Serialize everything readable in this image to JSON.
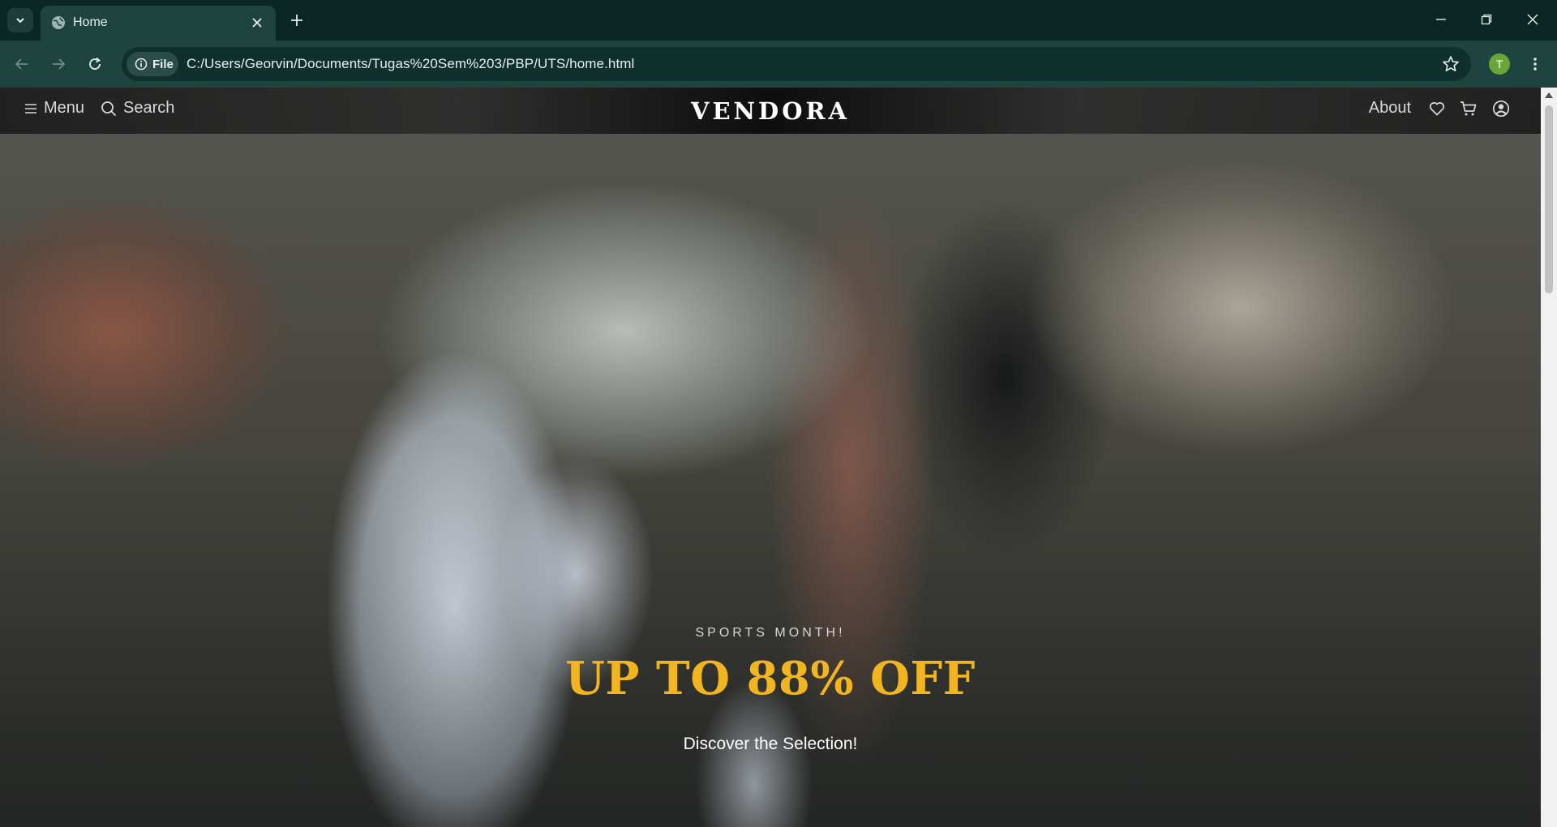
{
  "browser": {
    "tab_title": "Home",
    "address_chip": "File",
    "url": "C:/Users/Georvin/Documents/Tugas%20Sem%203/PBP/UTS/home.html",
    "profile_initial": "T",
    "profile_color": "#6aa53a"
  },
  "site": {
    "nav": {
      "menu_label": "Menu",
      "search_label": "Search",
      "brand": "VENDORA",
      "about_label": "About"
    },
    "hero": {
      "kicker": "SPORTS MONTH!",
      "headline": "UP TO 88% OFF",
      "cta": "Discover the Selection!",
      "accent_color": "#f2b41f"
    }
  },
  "icons": [
    "chevron-down-icon",
    "globe-icon",
    "close-icon",
    "plus-icon",
    "minimize-icon",
    "restore-icon",
    "back-icon",
    "forward-icon",
    "reload-icon",
    "info-icon",
    "star-icon",
    "kebab-icon",
    "hamburger-icon",
    "search-icon",
    "heart-icon",
    "cart-icon",
    "user-circle-icon"
  ]
}
